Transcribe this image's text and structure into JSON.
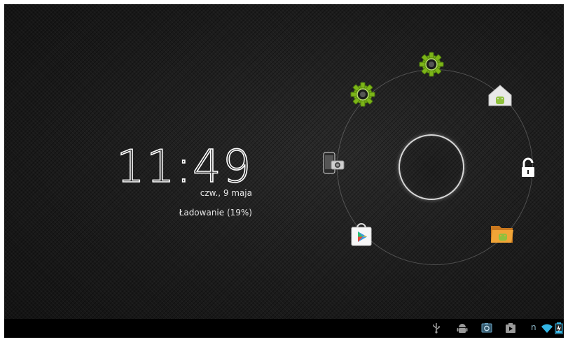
{
  "lockscreen": {
    "time": "11:49",
    "date": "czw., 9 maja",
    "charging_status": "Ładowanie (19%)"
  },
  "unlock_ring": {
    "targets": [
      {
        "name": "settings-gear-icon"
      },
      {
        "name": "settings-gear-icon"
      },
      {
        "name": "home-icon"
      },
      {
        "name": "unlock-icon"
      },
      {
        "name": "file-manager-icon"
      },
      {
        "name": "play-store-icon"
      },
      {
        "name": "phone-camera-icon"
      }
    ]
  },
  "status_bar": {
    "carrier_letter": "n",
    "icons": [
      "usb-icon",
      "android-debug-icon",
      "screenshot-icon",
      "media-icon",
      "wifi-icon",
      "battery-icon"
    ]
  },
  "colors": {
    "background": "#1c1c1c",
    "gear_green": "#7cb518",
    "clock_text": "#ffffff"
  }
}
